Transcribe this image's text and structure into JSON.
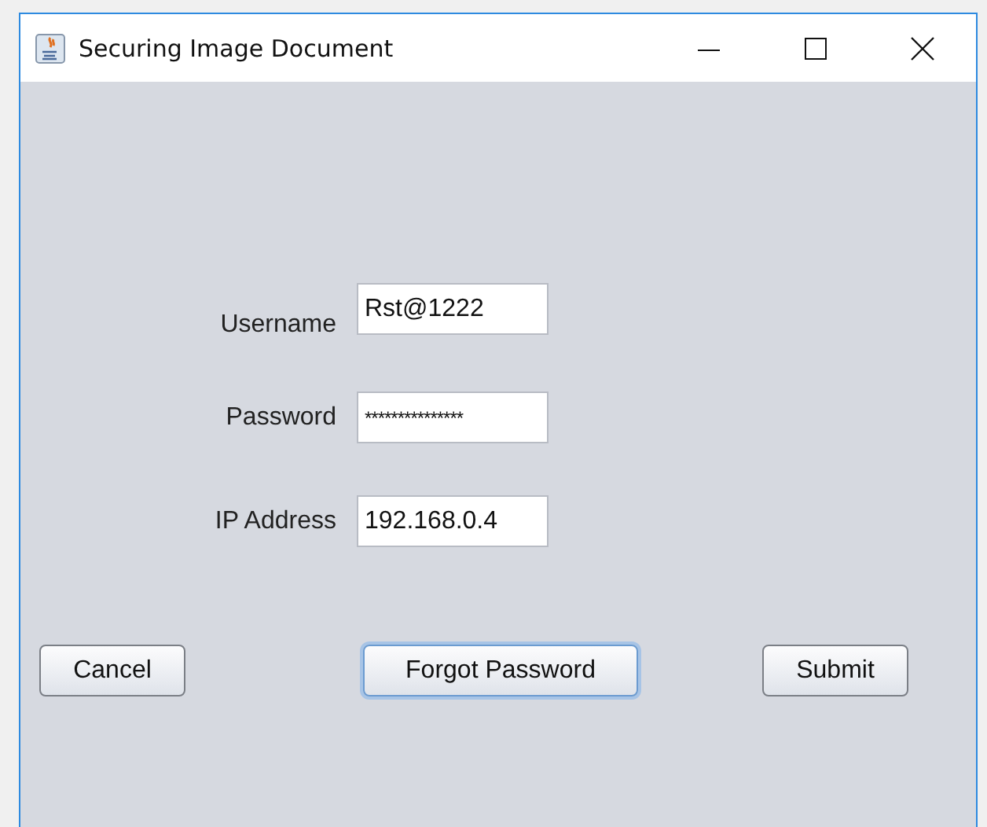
{
  "window": {
    "title": "Securing Image Document"
  },
  "fields": [
    {
      "label": "Username",
      "value": "Rst@1222"
    },
    {
      "label": "Password",
      "value": "***************"
    },
    {
      "label": "IP Address",
      "value": "192.168.0.4"
    }
  ],
  "buttons": [
    {
      "label": "Cancel",
      "focused": false
    },
    {
      "label": "Forgot Password",
      "focused": true
    },
    {
      "label": "Submit",
      "focused": false
    }
  ]
}
